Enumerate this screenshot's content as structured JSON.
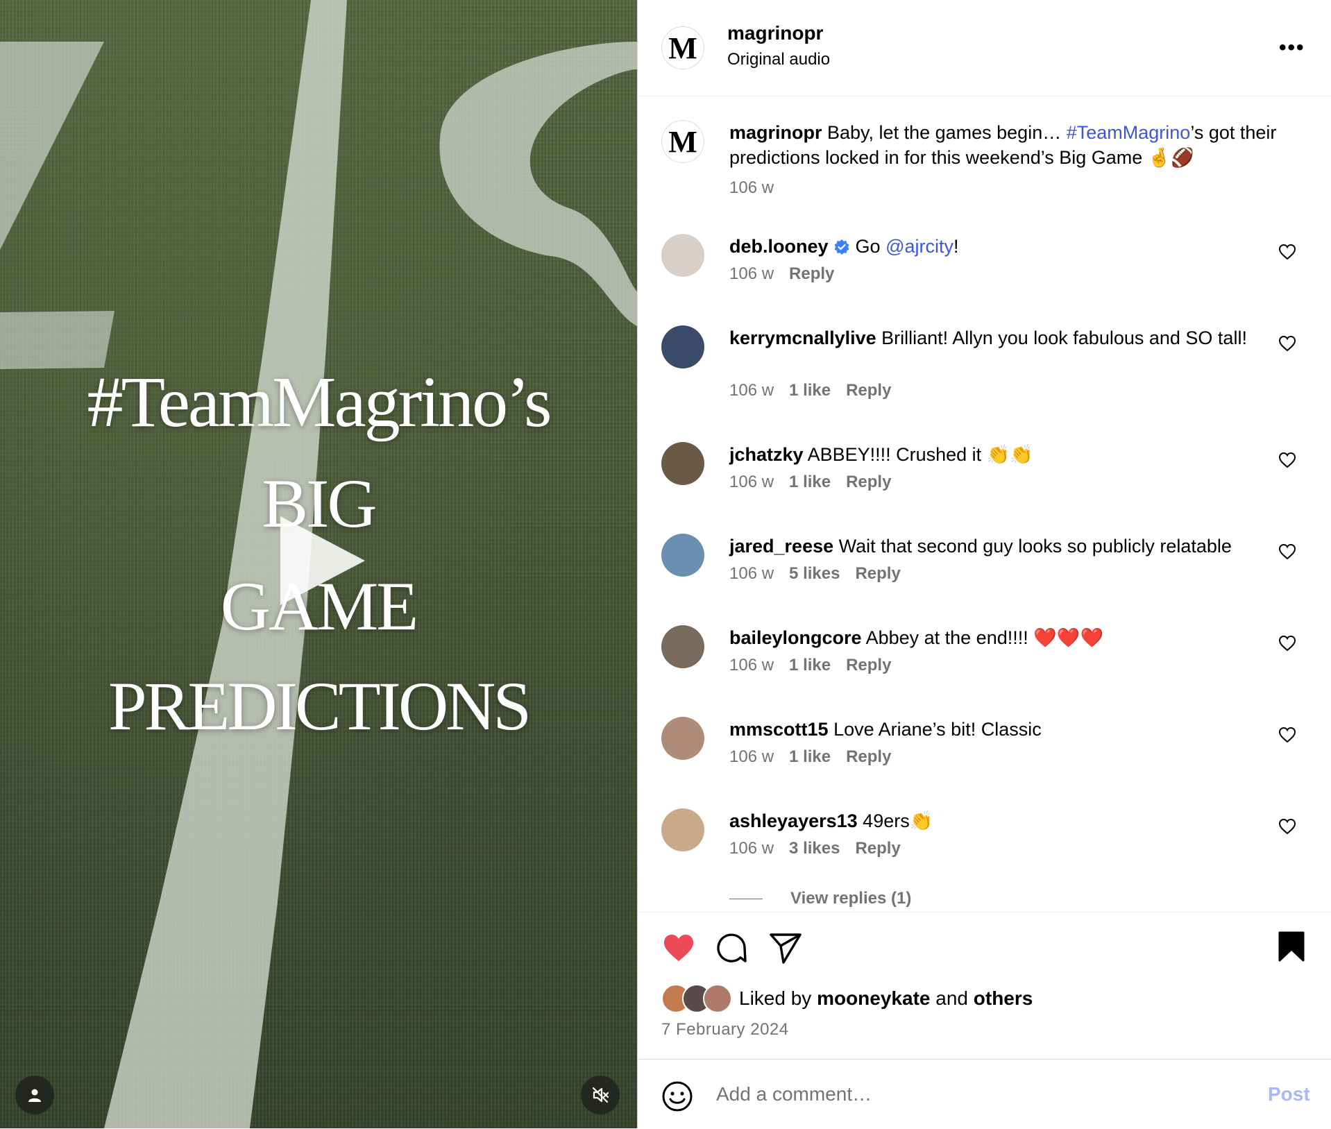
{
  "video": {
    "overlay_lines": [
      "#TeamMagrino’s",
      "BIG",
      "GAME",
      "PREDICTIONS"
    ]
  },
  "header": {
    "avatar_letter": "M",
    "username": "magrinopr",
    "subtitle": "Original audio",
    "more_label": "•••"
  },
  "caption": {
    "avatar_letter": "M",
    "username": "magrinopr",
    "text_before": " Baby, let the games begin… ",
    "hashtag": "#TeamMagrino",
    "text_after": "’s got their predictions locked in for this weekend’s Big Game 🤞🏈",
    "time": "106 w"
  },
  "comments": [
    {
      "username": "deb.looney",
      "verified": true,
      "text_before": " Go ",
      "mention": "@ajrcity",
      "text_after": "!",
      "time": "106 w",
      "likes": "",
      "reply": "Reply",
      "avatar_color": "#d9cfc6"
    },
    {
      "username": "kerrymcnallylive",
      "text": " Brilliant! Allyn you look fabulous and SO tall!",
      "time": "106 w",
      "likes": "1 like",
      "reply": "Reply",
      "avatar_color": "#3a4a6a"
    },
    {
      "username": "jchatzky",
      "text": " ABBEY!!!! Crushed it 👏👏",
      "time": "106 w",
      "likes": "1 like",
      "reply": "Reply",
      "avatar_color": "#6b5a45"
    },
    {
      "username": "jared_reese",
      "text": " Wait that second guy looks so publicly relatable",
      "time": "106 w",
      "likes": "5 likes",
      "reply": "Reply",
      "avatar_color": "#6a8fb0"
    },
    {
      "username": "baileylongcore",
      "text": " Abbey at the end!!!! ❤️❤️❤️",
      "time": "106 w",
      "likes": "1 like",
      "reply": "Reply",
      "avatar_color": "#7a6a5c"
    },
    {
      "username": "mmscott15",
      "text": " Love Ariane’s bit! Classic",
      "time": "106 w",
      "likes": "1 like",
      "reply": "Reply",
      "avatar_color": "#b08b7a"
    },
    {
      "username": "ashleyayers13",
      "text": " 49ers👏",
      "time": "106 w",
      "likes": "3 likes",
      "reply": "Reply",
      "avatar_color": "#c9a98a"
    }
  ],
  "view_replies": "View replies (1)",
  "footer": {
    "liked_prefix": "Liked by ",
    "liked_user": "mooneykate",
    "liked_mid": " and ",
    "liked_others": "others",
    "date": "7 February 2024",
    "placeholder": "Add a comment…",
    "post_label": "Post",
    "colors": {
      "like": "#ed4956",
      "post_disabled": "#a7b8f5",
      "link": "#3b57d8"
    }
  }
}
